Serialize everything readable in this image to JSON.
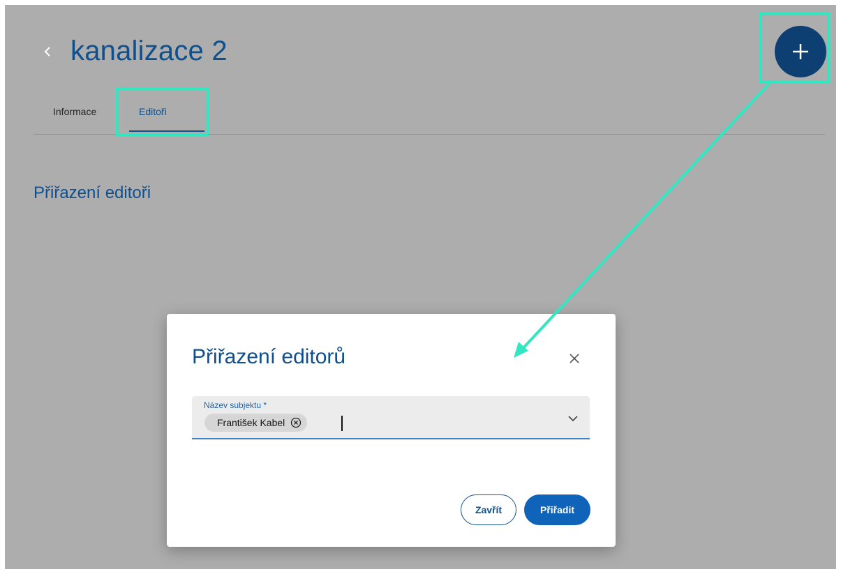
{
  "page": {
    "title": "kanalizace 2",
    "back_icon": "chevron-left-icon",
    "add_icon": "plus-icon"
  },
  "tabs": [
    {
      "label": "Informace",
      "active": false
    },
    {
      "label": "Editoři",
      "active": true
    }
  ],
  "section": {
    "title": "Přiřazení editoři"
  },
  "dialog": {
    "title": "Přiřazení editorů",
    "close_icon": "close-icon",
    "field": {
      "label": "Název subjektu *",
      "selected_chips": [
        "František Kabel"
      ],
      "chip_remove_icon": "cancel-circle-icon",
      "dropdown_icon": "chevron-down-icon"
    },
    "buttons": {
      "close_label": "Zavřít",
      "assign_label": "Přiřadit"
    }
  },
  "colors": {
    "overlay": "#adadad",
    "primary": "#0f4f8e",
    "primary_button": "#0f63b8",
    "annotation": "#33e6c2"
  }
}
